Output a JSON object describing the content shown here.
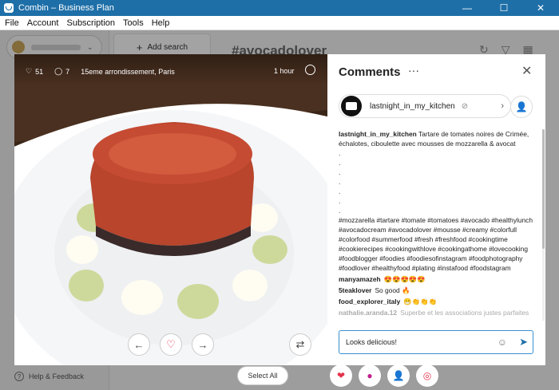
{
  "window": {
    "title": "Combin – Business Plan",
    "minimize": "—",
    "maximize": "☐",
    "close": "✕"
  },
  "menu": [
    "File",
    "Account",
    "Subscription",
    "Tools",
    "Help"
  ],
  "sidebar": {
    "help_label": "Help & Feedback"
  },
  "topbar": {
    "add_search_label": "Add search",
    "search_title": "#avocadolover"
  },
  "post": {
    "likes": "51",
    "comments": "7",
    "location": "15eme arrondissement, Paris",
    "time_ago": "1 hour"
  },
  "comments_panel": {
    "title": "Comments",
    "author": "lastnight_in_my_kitchen",
    "items": [
      {
        "user": "lastnight_in_my_kitchen",
        "text": "Tartare de tomates noires de Crimée, échalotes, ciboulette avec mousses de mozzarella & avocat\n.\n.\n.\n.\n.\n.\n.\n#mozzarella #tartare #tomate #tomatoes #avocado #healthylunch #avocadocream #avocadolover #mousse #creamy #colorfull #colorfood #summerfood #fresh #freshfood #cookingtime #cookierecipes #cookingwithlove #cookingathome #lovecooking #foodblogger #foodies #foodiesofinstagram #foodphotography #foodlover #healthyfood #plating #instafood #foodstagram"
      },
      {
        "user": "manyamazeh",
        "text": "😍😍😍😍😍"
      },
      {
        "user": "5teaklover",
        "text": "So good 🔥"
      },
      {
        "user": "food_explorer_italy",
        "text": "😁👏👏👏"
      },
      {
        "user": "nathalie.aranda.12",
        "text": "Superbe et les associations justes parfaites"
      }
    ],
    "input_value": "Looks delicious!"
  },
  "bottom": {
    "select_all_label": "Select All"
  },
  "colors": {
    "accent": "#1e6fa8",
    "heart": "#e2334b",
    "bubble": "#c01e8a"
  }
}
